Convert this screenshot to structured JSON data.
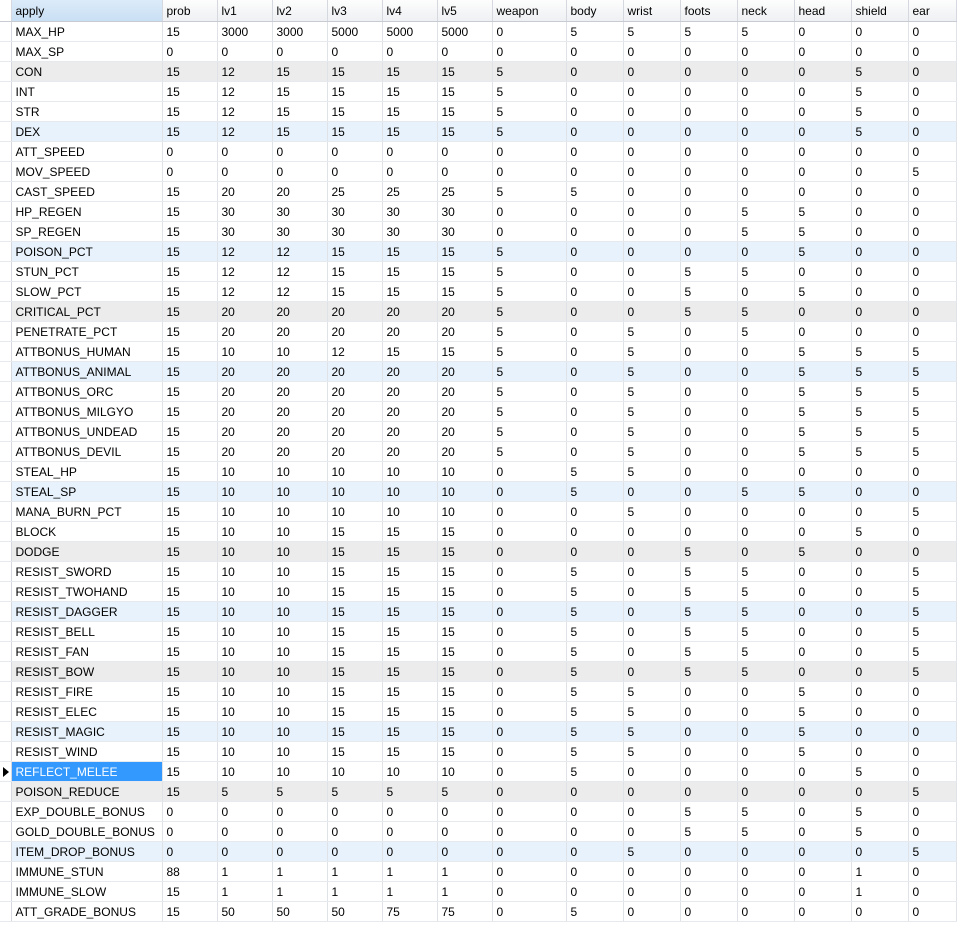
{
  "columns": [
    "apply",
    "prob",
    "lv1",
    "lv2",
    "lv3",
    "lv4",
    "lv5",
    "weapon",
    "body",
    "wrist",
    "foots",
    "neck",
    "head",
    "shield",
    "ear"
  ],
  "selected_row": 37,
  "rows": [
    [
      "MAX_HP",
      "15",
      "3000",
      "3000",
      "5000",
      "5000",
      "5000",
      "0",
      "5",
      "5",
      "5",
      "5",
      "0",
      "0",
      "0"
    ],
    [
      "MAX_SP",
      "0",
      "0",
      "0",
      "0",
      "0",
      "0",
      "0",
      "0",
      "0",
      "0",
      "0",
      "0",
      "0",
      "0"
    ],
    [
      "CON",
      "15",
      "12",
      "15",
      "15",
      "15",
      "15",
      "5",
      "0",
      "0",
      "0",
      "0",
      "0",
      "5",
      "0"
    ],
    [
      "INT",
      "15",
      "12",
      "15",
      "15",
      "15",
      "15",
      "5",
      "0",
      "0",
      "0",
      "0",
      "0",
      "5",
      "0"
    ],
    [
      "STR",
      "15",
      "12",
      "15",
      "15",
      "15",
      "15",
      "5",
      "0",
      "0",
      "0",
      "0",
      "0",
      "5",
      "0"
    ],
    [
      "DEX",
      "15",
      "12",
      "15",
      "15",
      "15",
      "15",
      "5",
      "0",
      "0",
      "0",
      "0",
      "0",
      "5",
      "0"
    ],
    [
      "ATT_SPEED",
      "0",
      "0",
      "0",
      "0",
      "0",
      "0",
      "0",
      "0",
      "0",
      "0",
      "0",
      "0",
      "0",
      "0"
    ],
    [
      "MOV_SPEED",
      "0",
      "0",
      "0",
      "0",
      "0",
      "0",
      "0",
      "0",
      "0",
      "0",
      "0",
      "0",
      "0",
      "5"
    ],
    [
      "CAST_SPEED",
      "15",
      "20",
      "20",
      "25",
      "25",
      "25",
      "5",
      "5",
      "0",
      "0",
      "0",
      "0",
      "0",
      "0"
    ],
    [
      "HP_REGEN",
      "15",
      "30",
      "30",
      "30",
      "30",
      "30",
      "0",
      "0",
      "0",
      "0",
      "5",
      "5",
      "0",
      "0"
    ],
    [
      "SP_REGEN",
      "15",
      "30",
      "30",
      "30",
      "30",
      "30",
      "0",
      "0",
      "0",
      "0",
      "5",
      "5",
      "0",
      "0"
    ],
    [
      "POISON_PCT",
      "15",
      "12",
      "12",
      "15",
      "15",
      "15",
      "5",
      "0",
      "0",
      "0",
      "0",
      "5",
      "0",
      "0"
    ],
    [
      "STUN_PCT",
      "15",
      "12",
      "12",
      "15",
      "15",
      "15",
      "5",
      "0",
      "0",
      "5",
      "5",
      "0",
      "0",
      "0"
    ],
    [
      "SLOW_PCT",
      "15",
      "12",
      "12",
      "15",
      "15",
      "15",
      "5",
      "0",
      "0",
      "5",
      "0",
      "5",
      "0",
      "0"
    ],
    [
      "CRITICAL_PCT",
      "15",
      "20",
      "20",
      "20",
      "20",
      "20",
      "5",
      "0",
      "0",
      "5",
      "5",
      "0",
      "0",
      "0"
    ],
    [
      "PENETRATE_PCT",
      "15",
      "20",
      "20",
      "20",
      "20",
      "20",
      "5",
      "0",
      "5",
      "0",
      "5",
      "0",
      "0",
      "0"
    ],
    [
      "ATTBONUS_HUMAN",
      "15",
      "10",
      "10",
      "12",
      "15",
      "15",
      "5",
      "0",
      "5",
      "0",
      "0",
      "5",
      "5",
      "5"
    ],
    [
      "ATTBONUS_ANIMAL",
      "15",
      "20",
      "20",
      "20",
      "20",
      "20",
      "5",
      "0",
      "5",
      "0",
      "0",
      "5",
      "5",
      "5"
    ],
    [
      "ATTBONUS_ORC",
      "15",
      "20",
      "20",
      "20",
      "20",
      "20",
      "5",
      "0",
      "5",
      "0",
      "0",
      "5",
      "5",
      "5"
    ],
    [
      "ATTBONUS_MILGYO",
      "15",
      "20",
      "20",
      "20",
      "20",
      "20",
      "5",
      "0",
      "5",
      "0",
      "0",
      "5",
      "5",
      "5"
    ],
    [
      "ATTBONUS_UNDEAD",
      "15",
      "20",
      "20",
      "20",
      "20",
      "20",
      "5",
      "0",
      "5",
      "0",
      "0",
      "5",
      "5",
      "5"
    ],
    [
      "ATTBONUS_DEVIL",
      "15",
      "20",
      "20",
      "20",
      "20",
      "20",
      "5",
      "0",
      "5",
      "0",
      "0",
      "5",
      "5",
      "5"
    ],
    [
      "STEAL_HP",
      "15",
      "10",
      "10",
      "10",
      "10",
      "10",
      "0",
      "5",
      "5",
      "0",
      "0",
      "0",
      "0",
      "0"
    ],
    [
      "STEAL_SP",
      "15",
      "10",
      "10",
      "10",
      "10",
      "10",
      "0",
      "5",
      "0",
      "0",
      "5",
      "5",
      "0",
      "0"
    ],
    [
      "MANA_BURN_PCT",
      "15",
      "10",
      "10",
      "10",
      "10",
      "10",
      "0",
      "0",
      "5",
      "0",
      "0",
      "0",
      "0",
      "5"
    ],
    [
      "BLOCK",
      "15",
      "10",
      "10",
      "15",
      "15",
      "15",
      "0",
      "0",
      "0",
      "0",
      "0",
      "0",
      "5",
      "0"
    ],
    [
      "DODGE",
      "15",
      "10",
      "10",
      "15",
      "15",
      "15",
      "0",
      "0",
      "0",
      "5",
      "0",
      "5",
      "0",
      "0"
    ],
    [
      "RESIST_SWORD",
      "15",
      "10",
      "10",
      "15",
      "15",
      "15",
      "0",
      "5",
      "0",
      "5",
      "5",
      "0",
      "0",
      "5"
    ],
    [
      "RESIST_TWOHAND",
      "15",
      "10",
      "10",
      "15",
      "15",
      "15",
      "0",
      "5",
      "0",
      "5",
      "5",
      "0",
      "0",
      "5"
    ],
    [
      "RESIST_DAGGER",
      "15",
      "10",
      "10",
      "15",
      "15",
      "15",
      "0",
      "5",
      "0",
      "5",
      "5",
      "0",
      "0",
      "5"
    ],
    [
      "RESIST_BELL",
      "15",
      "10",
      "10",
      "15",
      "15",
      "15",
      "0",
      "5",
      "0",
      "5",
      "5",
      "0",
      "0",
      "5"
    ],
    [
      "RESIST_FAN",
      "15",
      "10",
      "10",
      "15",
      "15",
      "15",
      "0",
      "5",
      "0",
      "5",
      "5",
      "0",
      "0",
      "5"
    ],
    [
      "RESIST_BOW",
      "15",
      "10",
      "10",
      "15",
      "15",
      "15",
      "0",
      "5",
      "0",
      "5",
      "5",
      "0",
      "0",
      "5"
    ],
    [
      "RESIST_FIRE",
      "15",
      "10",
      "10",
      "15",
      "15",
      "15",
      "0",
      "5",
      "5",
      "0",
      "0",
      "5",
      "0",
      "0"
    ],
    [
      "RESIST_ELEC",
      "15",
      "10",
      "10",
      "15",
      "15",
      "15",
      "0",
      "5",
      "5",
      "0",
      "0",
      "5",
      "0",
      "0"
    ],
    [
      "RESIST_MAGIC",
      "15",
      "10",
      "10",
      "15",
      "15",
      "15",
      "0",
      "5",
      "5",
      "0",
      "0",
      "5",
      "0",
      "0"
    ],
    [
      "RESIST_WIND",
      "15",
      "10",
      "10",
      "15",
      "15",
      "15",
      "0",
      "5",
      "5",
      "0",
      "0",
      "5",
      "0",
      "0"
    ],
    [
      "REFLECT_MELEE",
      "15",
      "10",
      "10",
      "10",
      "10",
      "10",
      "0",
      "5",
      "0",
      "0",
      "0",
      "0",
      "5",
      "0"
    ],
    [
      "POISON_REDUCE",
      "15",
      "5",
      "5",
      "5",
      "5",
      "5",
      "0",
      "0",
      "0",
      "0",
      "0",
      "0",
      "0",
      "5"
    ],
    [
      "EXP_DOUBLE_BONUS",
      "0",
      "0",
      "0",
      "0",
      "0",
      "0",
      "0",
      "0",
      "0",
      "5",
      "5",
      "0",
      "5",
      "0"
    ],
    [
      "GOLD_DOUBLE_BONUS",
      "0",
      "0",
      "0",
      "0",
      "0",
      "0",
      "0",
      "0",
      "0",
      "5",
      "5",
      "0",
      "5",
      "0"
    ],
    [
      "ITEM_DROP_BONUS",
      "0",
      "0",
      "0",
      "0",
      "0",
      "0",
      "0",
      "0",
      "5",
      "0",
      "0",
      "0",
      "0",
      "5"
    ],
    [
      "IMMUNE_STUN",
      "88",
      "1",
      "1",
      "1",
      "1",
      "1",
      "0",
      "0",
      "0",
      "0",
      "0",
      "0",
      "1",
      "0"
    ],
    [
      "IMMUNE_SLOW",
      "15",
      "1",
      "1",
      "1",
      "1",
      "1",
      "0",
      "0",
      "0",
      "0",
      "0",
      "0",
      "1",
      "0"
    ],
    [
      "ATT_GRADE_BONUS",
      "15",
      "50",
      "50",
      "50",
      "75",
      "75",
      "0",
      "5",
      "0",
      "0",
      "0",
      "0",
      "0",
      "0"
    ]
  ]
}
